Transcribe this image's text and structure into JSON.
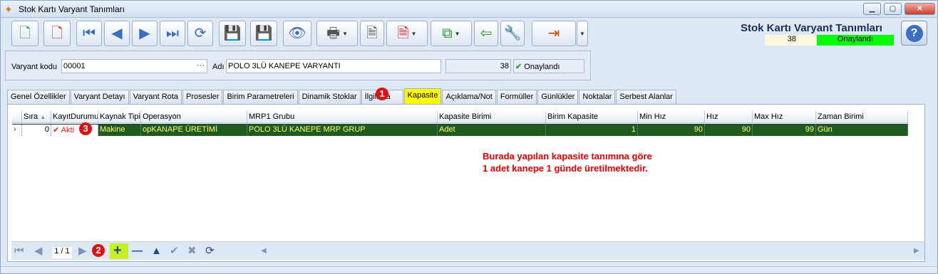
{
  "window": {
    "title": "Stok Kartı Varyant Tanımları"
  },
  "header": {
    "title": "Stok Kartı Varyant Tanımları",
    "record_no": "38",
    "status": "Onaylandı",
    "help_label": "?"
  },
  "form": {
    "variant_code_label": "Varyant kodu",
    "variant_code_value": "00001",
    "name_label": "Adı",
    "name_value": "POLO 3LÜ KANEPE VARYANTI",
    "record_no": "38",
    "approval_label": "Onaylandı"
  },
  "tabs": [
    "Genel Özellikler",
    "Varyant Detayı",
    "Varyant Rota",
    "Prosesler",
    "Birim Parametreleri",
    "Dinamik Stoklar",
    "İlgili Ca",
    "Kapasite",
    "Açıklama/Not",
    "Formüller",
    "Günlükler",
    "Noktalar",
    "Serbest Alanlar"
  ],
  "active_tab": "Kapasite",
  "grid": {
    "columns": [
      "Sıra",
      "KayıtDurumu",
      "Kaynak Tipi",
      "Operasyon",
      "MRP1 Grubu",
      "Kapasite Birimi",
      "Birim Kapasite",
      "Min Hız",
      "Hız",
      "Max Hız",
      "Zaman Birimi"
    ],
    "row": {
      "sira": "0",
      "durum": "Akti",
      "kaynak": "Makine",
      "operasyon": "opKANAPE ÜRETİMİ",
      "mrp": "POLO 3LÜ KANEPE MRP GRUP",
      "kap_birimi": "Adet",
      "birim_kap": "1",
      "min_hiz": "90",
      "hiz": "90",
      "max_hiz": "99",
      "zaman": "Gün"
    }
  },
  "note": {
    "line1": "Burada yapılan kapasite tanımına göre",
    "line2": "1 adet kanepe 1 günde üretilmektedir."
  },
  "navigator": {
    "page": "1 / 1"
  },
  "badges": {
    "b1": "1",
    "b2": "2",
    "b3": "3"
  },
  "colors": {
    "active_tab": "#ffff00",
    "status_ok": "#00ff00",
    "selected_row": "#1e4f8d",
    "note": "#e00000"
  }
}
